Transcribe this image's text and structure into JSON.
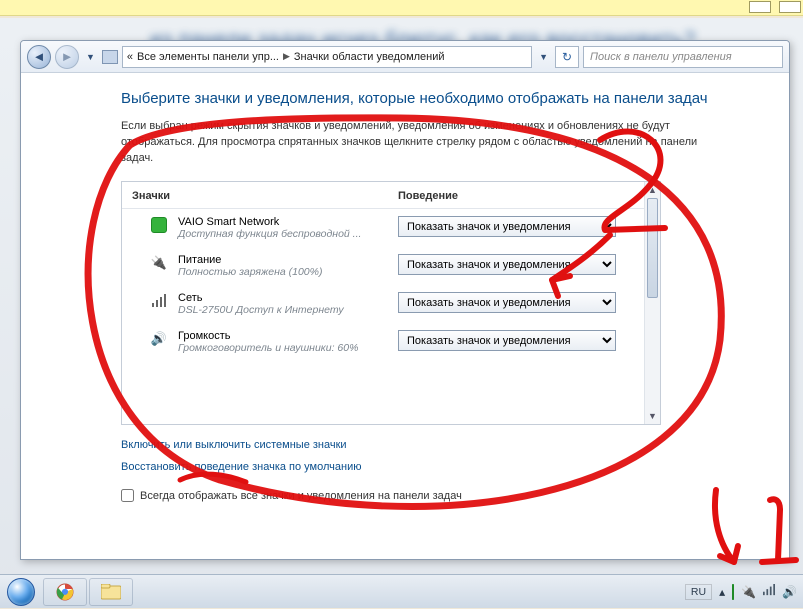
{
  "breadcrumb": {
    "root_hint": "«",
    "part1": "Все элементы панели упр...",
    "part2": "Значки области уведомлений"
  },
  "search": {
    "placeholder": "Поиск в панели управления"
  },
  "page": {
    "title": "Выберите значки и уведомления, которые необходимо отображать на панели задач",
    "desc": "Если выбран режим скрытия значков и уведомлений, уведомления об изменениях и обновлениях не будут отображаться. Для просмотра спрятанных значков щелкните стрелку рядом с областью уведомлений на панели задач."
  },
  "columns": {
    "icons": "Значки",
    "behavior": "Поведение"
  },
  "dropdown_option": "Показать значок и уведомления",
  "rows": [
    {
      "icon": "vaio",
      "name": "VAIO Smart Network",
      "sub": "Доступная функция беспроводной ..."
    },
    {
      "icon": "power",
      "name": "Питание",
      "sub": "Полностью заряжена (100%)"
    },
    {
      "icon": "network",
      "name": "Сеть",
      "sub": "DSL-2750U Доступ к Интернету"
    },
    {
      "icon": "volume",
      "name": "Громкость",
      "sub": "Громкоговоритель и наушники: 60%"
    }
  ],
  "links": {
    "toggle_system": "Включить или выключить системные значки",
    "restore_default": "Восстановить поведение значка по умолчанию"
  },
  "checkbox_label": "Всегда отображать все значки и уведомления на панели задач",
  "tray": {
    "lang": "RU"
  },
  "bg_blur_title": "из панели задач исчез блютус, как его восстановить?"
}
